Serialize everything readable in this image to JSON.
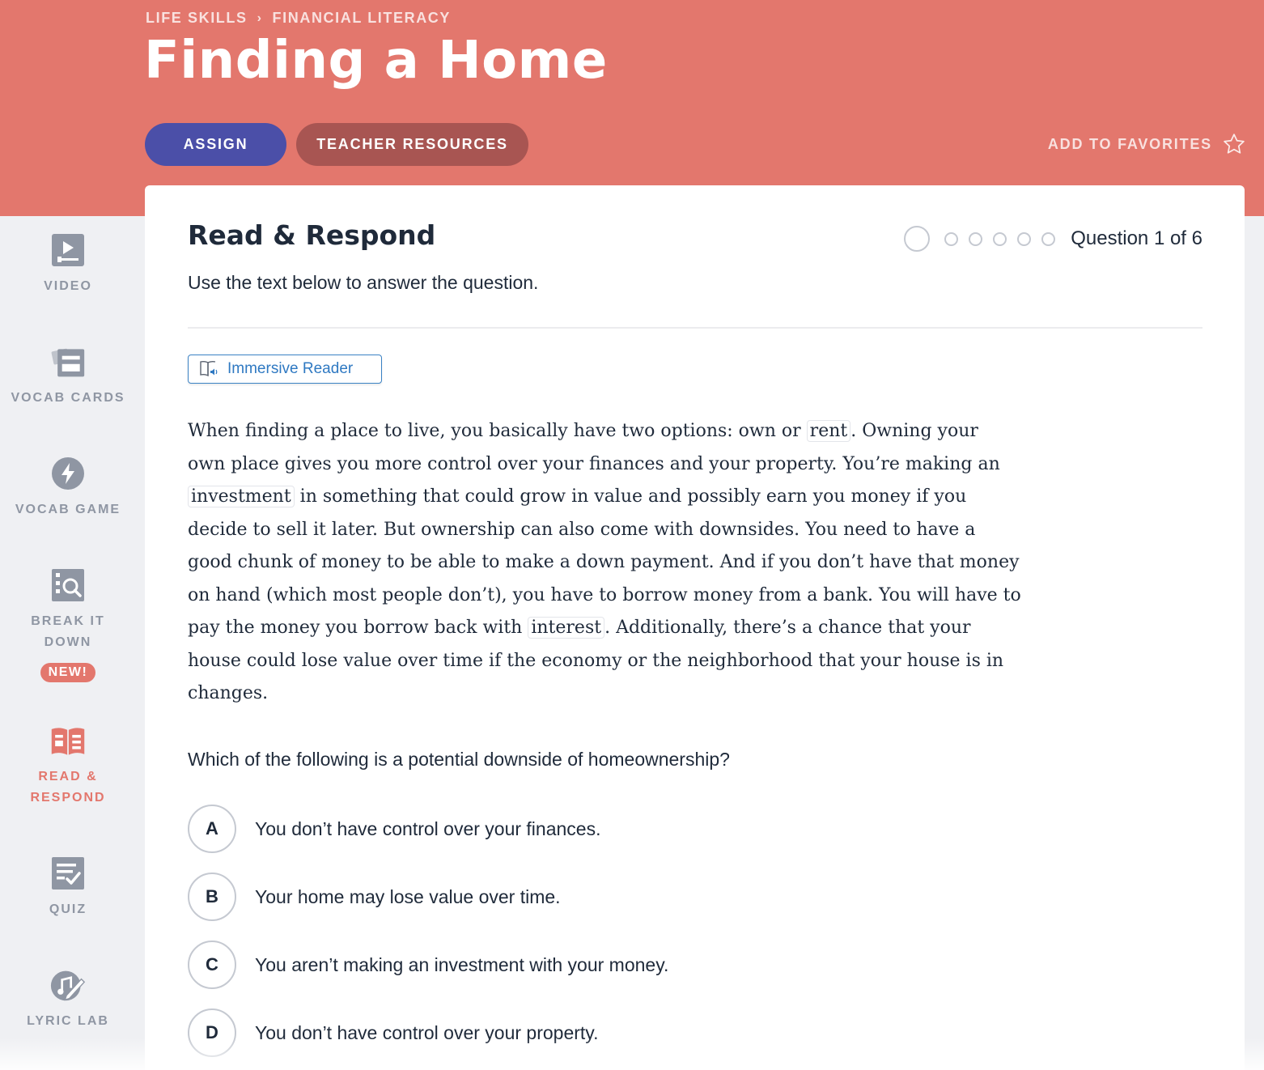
{
  "header": {
    "breadcrumb": [
      "LIFE SKILLS",
      "FINANCIAL LITERACY"
    ],
    "breadcrumb_separator": "›",
    "title": "Finding a Home",
    "assign_label": "ASSIGN",
    "teacher_resources_label": "TEACHER RESOURCES",
    "favorites_label": "ADD TO FAVORITES",
    "favorites_icon": "star-outline-icon"
  },
  "colors": {
    "header_bg": "#e3776d",
    "assign_bg": "#4b4fa8",
    "resources_bg": "#a85552",
    "accent_link": "#2f79c2",
    "sidebar_bg": "#eff0f3",
    "sidebar_inactive": "#8f96a3",
    "sidebar_active": "#e3776d"
  },
  "sidebar": {
    "items": [
      {
        "label": "VIDEO",
        "icon": "video-icon"
      },
      {
        "label": "VOCAB CARDS",
        "icon": "vocab-cards-icon"
      },
      {
        "label": "VOCAB GAME",
        "icon": "lightning-icon"
      },
      {
        "label": "BREAK IT DOWN",
        "icon": "magnifier-grid-icon",
        "badge": "NEW!"
      },
      {
        "label": "READ & RESPOND",
        "icon": "open-book-icon",
        "active": true
      },
      {
        "label": "QUIZ",
        "icon": "checklist-icon"
      },
      {
        "label": "LYRIC LAB",
        "icon": "music-pen-icon"
      }
    ]
  },
  "activity": {
    "title": "Read & Respond",
    "question_counter": "Question 1 of 6",
    "current_question": 1,
    "total_questions": 6,
    "instructions": "Use the text below to answer the question.",
    "immersive_reader_label": "Immersive Reader",
    "passage": {
      "p1": "When finding a place to live, you basically have two options: own or ",
      "v1": "rent",
      "p2": ". Owning your own place gives you more control over your finances and your property. You’re making an ",
      "v2": "investment",
      "p3": " in something that could grow in value and possibly earn you money if you decide to sell it later. But ownership can also come with downsides. You need to have a good chunk of money to be able to make a down payment. And if you don’t have that money on hand (which most people don’t), you have to borrow money from a bank. You will have to pay the money you borrow back with ",
      "v3": "interest",
      "p4": ". Additionally, there’s a chance that your house could lose value over time if the economy or the neighborhood that your house is in changes."
    },
    "question": "Which of the following is a potential downside of homeownership?",
    "choices": [
      {
        "letter": "A",
        "text": "You don’t have control over your finances."
      },
      {
        "letter": "B",
        "text": "Your home may lose value over time."
      },
      {
        "letter": "C",
        "text": "You aren’t making an investment with your money."
      },
      {
        "letter": "D",
        "text": "You don’t have control over your property."
      }
    ]
  }
}
